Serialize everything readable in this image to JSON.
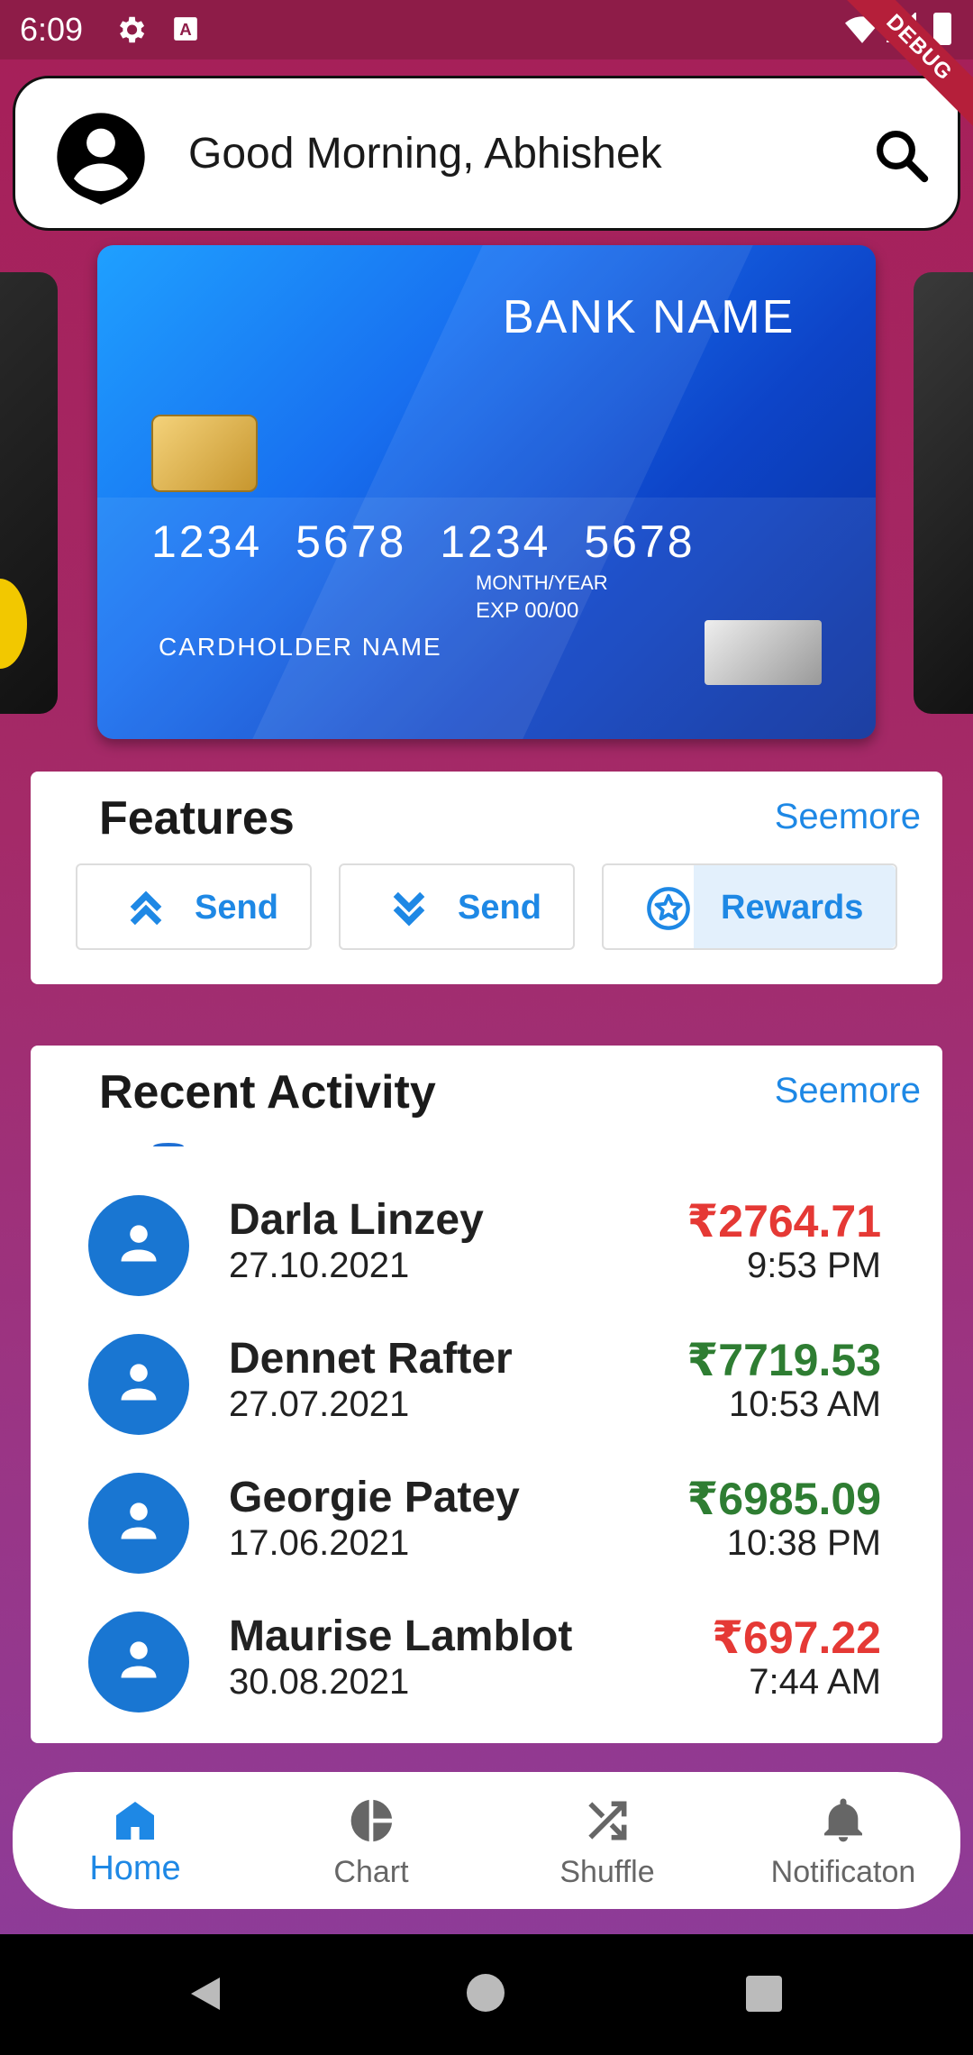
{
  "status_bar": {
    "time": "6:09",
    "debug_label": "DEBUG",
    "status_letter": "A"
  },
  "header": {
    "greeting": "Good Morning, Abhishek"
  },
  "card": {
    "bank_name": "BANK NAME",
    "number": "1234 5678 1234 5678",
    "month_year_label": "MONTH/YEAR",
    "exp_label": "EXP  00/00",
    "holder": "CARDHOLDER  NAME",
    "color_primary": "#1870f0"
  },
  "features": {
    "title": "Features",
    "seemore": "Seemore",
    "buttons": [
      {
        "label": "Send",
        "icon": "double-chevron-up-icon"
      },
      {
        "label": "Send",
        "icon": "double-chevron-down-icon"
      },
      {
        "label": "Rewards",
        "icon": "star-circle-icon"
      }
    ]
  },
  "recent_activity": {
    "title": "Recent Activity",
    "seemore": "Seemore",
    "items": [
      {
        "name": "Darla Linzey",
        "date": "27.10.2021",
        "amount": "₹2764.71",
        "time": "9:53 PM",
        "color": "#e53935"
      },
      {
        "name": "Dennet Rafter",
        "date": "27.07.2021",
        "amount": "₹7719.53",
        "time": "10:53 AM",
        "color": "#2e7d32"
      },
      {
        "name": "Georgie Patey",
        "date": "17.06.2021",
        "amount": "₹6985.09",
        "time": "10:38 PM",
        "color": "#2e7d32"
      },
      {
        "name": "Maurise Lamblot",
        "date": "30.08.2021",
        "amount": "₹697.22",
        "time": "7:44 AM",
        "color": "#e53935"
      }
    ]
  },
  "bottom_nav": {
    "items": [
      {
        "label": "Home",
        "icon": "home-icon",
        "active": true
      },
      {
        "label": "Chart",
        "icon": "pie-chart-icon",
        "active": false
      },
      {
        "label": "Shuffle",
        "icon": "shuffle-icon",
        "active": false
      },
      {
        "label": "Notificaton",
        "icon": "bell-icon",
        "active": false
      }
    ]
  },
  "colors": {
    "accent": "#1e88e5",
    "negative": "#e53935",
    "positive": "#2e7d32"
  }
}
